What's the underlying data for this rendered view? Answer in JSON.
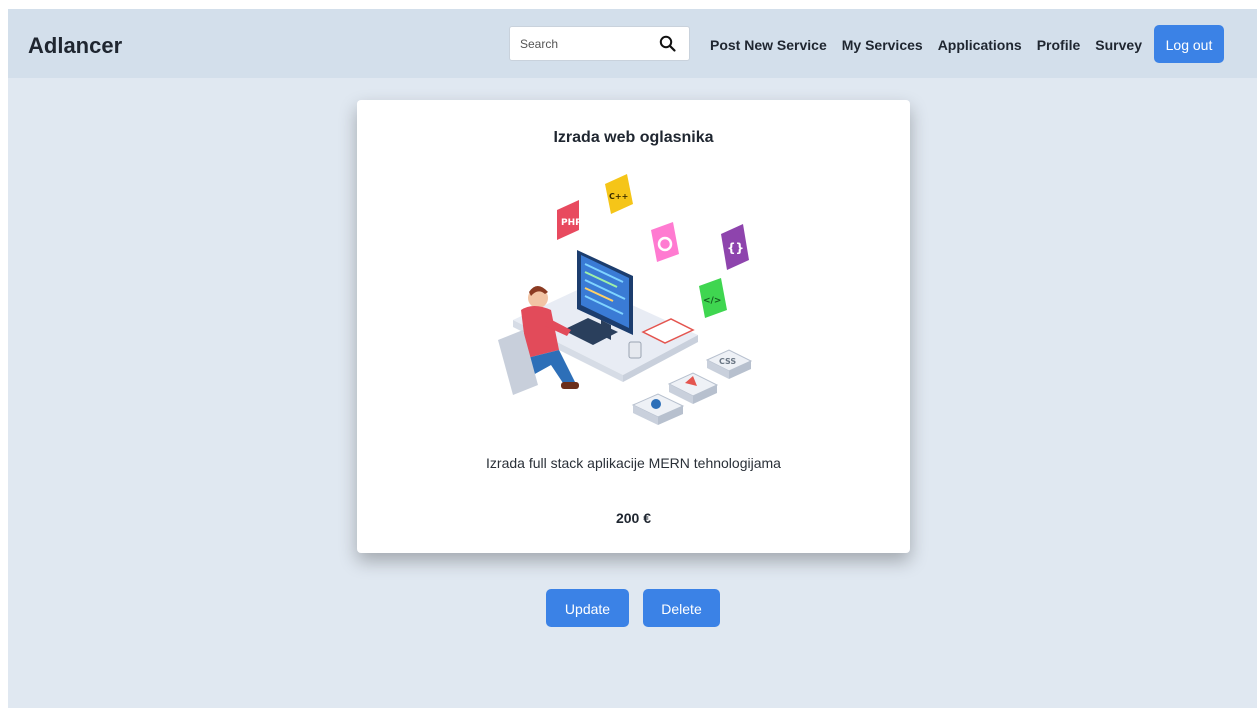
{
  "brand": "Adlancer",
  "search": {
    "placeholder": "Search",
    "value": ""
  },
  "nav": {
    "items": [
      "Post New Service",
      "My Services",
      "Applications",
      "Profile",
      "Survey"
    ],
    "logout_label": "Log out"
  },
  "service": {
    "title": "Izrada web oglasnika",
    "description": "Izrada full stack aplikacije MERN tehnologijama",
    "price": "200 €",
    "illustration": "developer-at-computer-illustration",
    "illustration_badges": [
      "PHP",
      "C++",
      "</>",
      "{}",
      "CSS"
    ]
  },
  "actions": {
    "update_label": "Update",
    "delete_label": "Delete"
  },
  "colors": {
    "page_bg": "#e0e8f1",
    "navbar_bg": "#d3dfeb",
    "primary_button": "#3b82e6"
  }
}
